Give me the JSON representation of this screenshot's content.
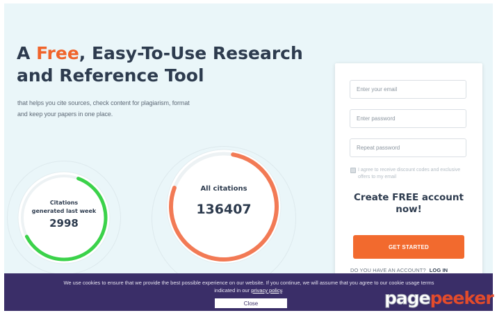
{
  "hero": {
    "title_prefix": "A ",
    "title_accent": "Free",
    "title_suffix": ", Easy-To-Use Research and Reference Tool",
    "subtitle_line1": "that helps you cite sources, check content for plagiarism, format",
    "subtitle_line2": "and keep your papers in one place."
  },
  "stats": {
    "weekly": {
      "label_line1": "Citations",
      "label_line2": "generated last week",
      "value": "2998",
      "progress": 0.62,
      "color": "#3bd24a"
    },
    "all": {
      "label": "All citations",
      "value": "136407",
      "progress": 0.78,
      "color": "#f27a55"
    }
  },
  "signup": {
    "email_placeholder": "Enter your email",
    "password_placeholder": "Enter password",
    "repeat_placeholder": "Repeat password",
    "agree_label": "I agree to receive discount codes and exclusive offers to my email",
    "cta_line1": "Create FREE account",
    "cta_line2": "now!",
    "button_label": "GET STARTED",
    "account_question": "DO YOU HAVE AN ACCOUNT?",
    "login_label": "LOG IN"
  },
  "cookie": {
    "text_line1": "We use cookies to ensure that we provide the best possible experience on our website. If you continue, we will assume that you agree to our cookie usage terms",
    "text_before_link": "indicated in our ",
    "policy_link": "privacy policy",
    "text_after_link": ".",
    "close_label": "Close"
  },
  "watermark": {
    "part1": "page",
    "part2": "peeker"
  },
  "colors": {
    "accent": "#f0642b",
    "heading": "#2d3b4e",
    "banner": "#3a2e68",
    "background": "#eaf6f9"
  }
}
